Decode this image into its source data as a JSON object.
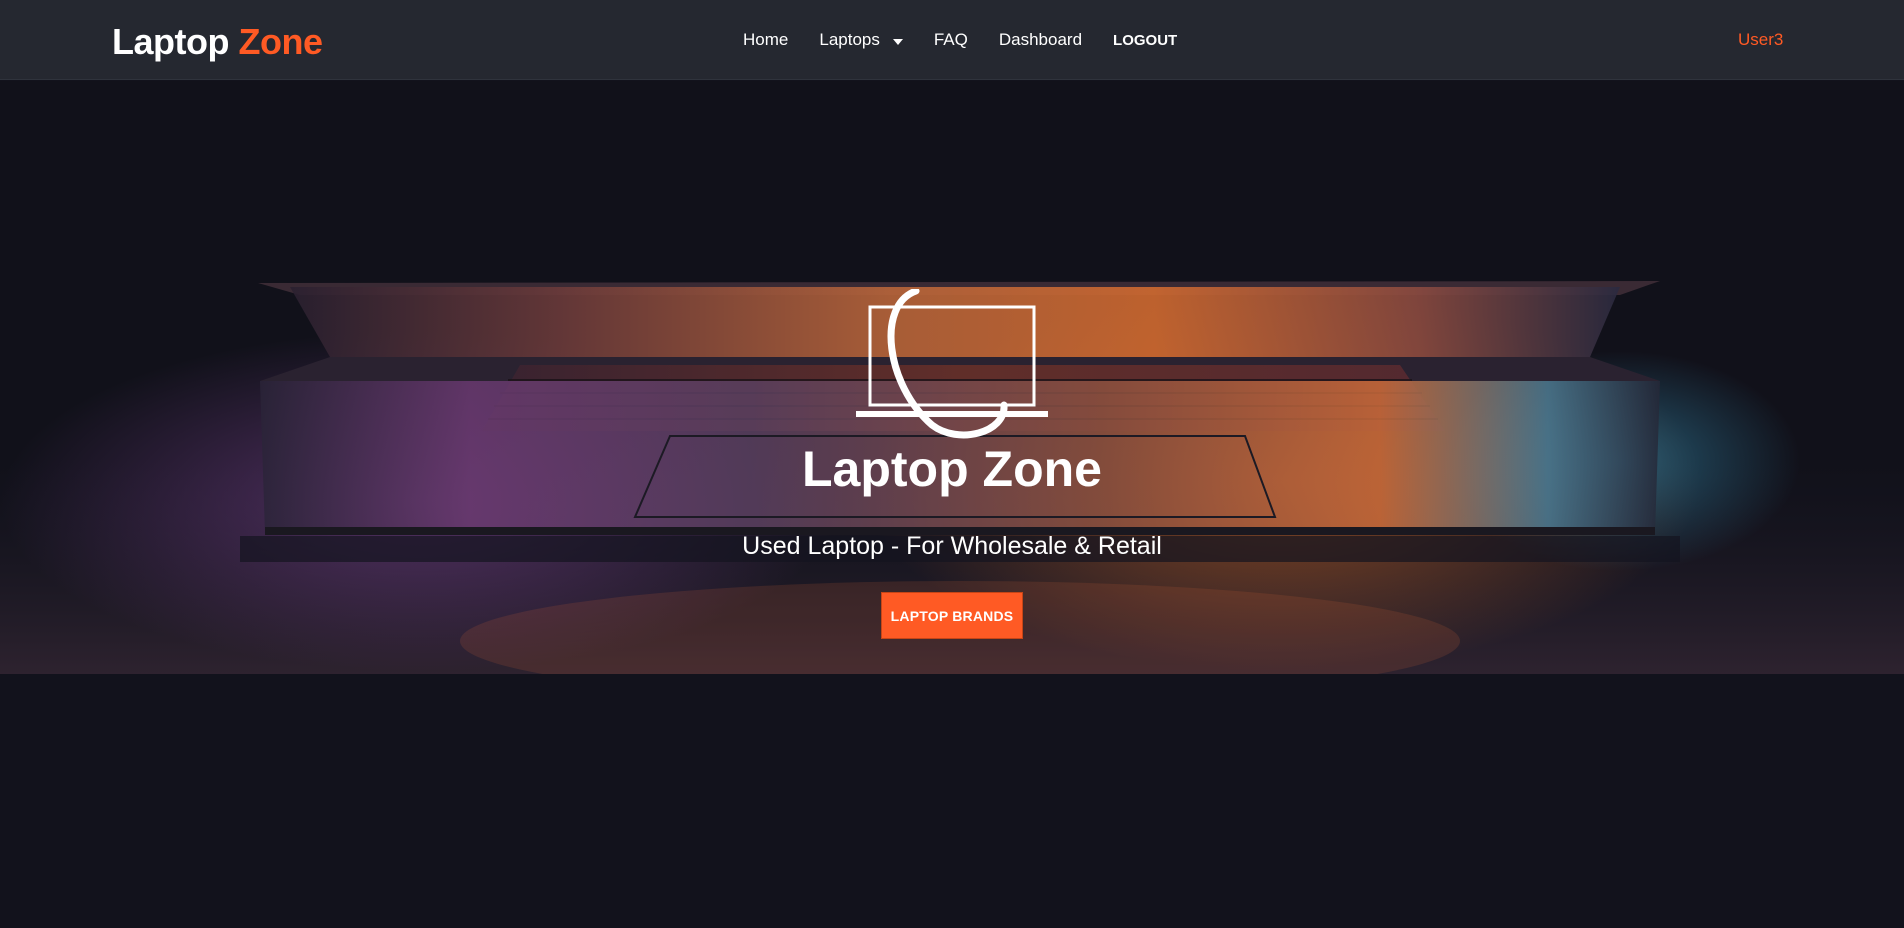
{
  "navbar": {
    "brand_part1": "Laptop",
    "brand_part2": "Zone",
    "links": [
      {
        "label": "Home"
      },
      {
        "label": "Laptops"
      },
      {
        "label": "FAQ"
      },
      {
        "label": "Dashboard"
      },
      {
        "label": "LOGOUT"
      }
    ],
    "user": "User3"
  },
  "hero": {
    "title": "Laptop Zone",
    "subtitle": "Used Laptop - For Wholesale & Retail",
    "button_label": "LAPTOP BRANDS",
    "icon": "laptop-logo-icon"
  },
  "colors": {
    "accent": "#ff5a24",
    "navbar_bg": "#252830",
    "page_bg": "#12121c"
  }
}
